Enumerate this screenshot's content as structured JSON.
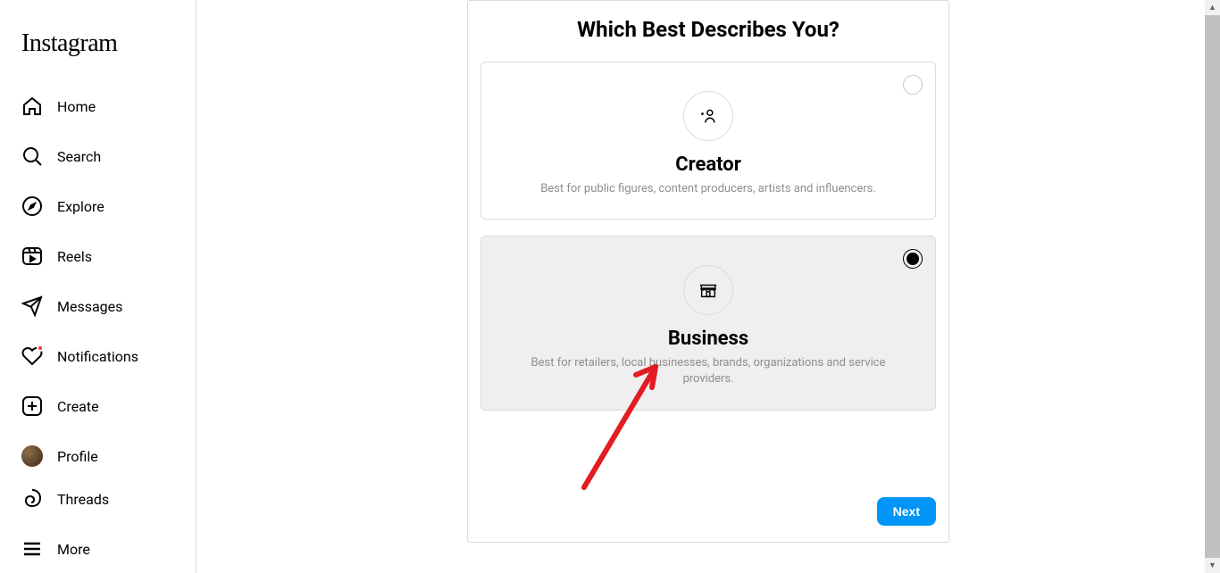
{
  "brand": "Instagram",
  "sidebar": {
    "items": [
      {
        "label": "Home",
        "icon": "home"
      },
      {
        "label": "Search",
        "icon": "search"
      },
      {
        "label": "Explore",
        "icon": "compass"
      },
      {
        "label": "Reels",
        "icon": "reels"
      },
      {
        "label": "Messages",
        "icon": "send"
      },
      {
        "label": "Notifications",
        "icon": "heart",
        "badge": true
      },
      {
        "label": "Create",
        "icon": "plus"
      },
      {
        "label": "Profile",
        "icon": "avatar"
      }
    ],
    "footer": [
      {
        "label": "Threads",
        "icon": "threads"
      },
      {
        "label": "More",
        "icon": "menu"
      }
    ]
  },
  "card": {
    "title": "Which Best Describes You?",
    "options": [
      {
        "title": "Creator",
        "description": "Best for public figures, content producers, artists and influencers.",
        "selected": false
      },
      {
        "title": "Business",
        "description": "Best for retailers, local businesses, brands, organizations and service providers.",
        "selected": true
      }
    ],
    "next_label": "Next"
  },
  "annotation": {
    "arrow_color": "#e31b23"
  }
}
